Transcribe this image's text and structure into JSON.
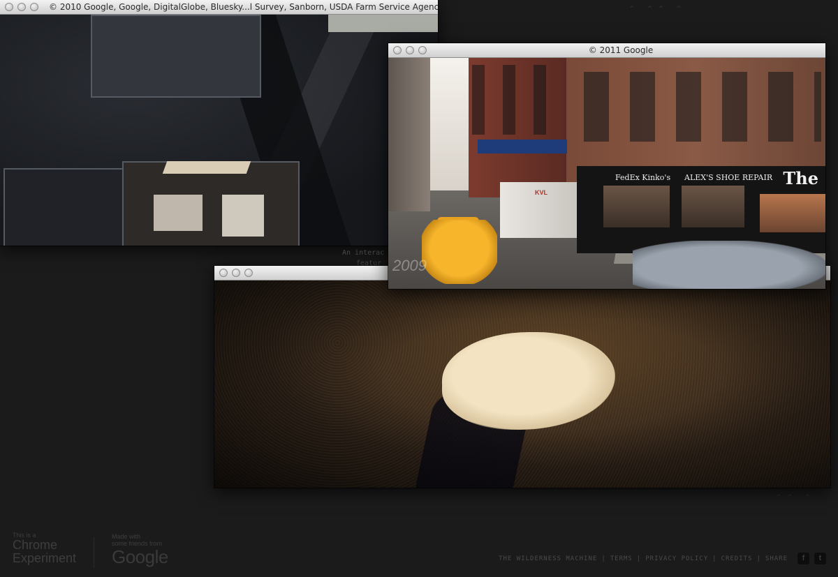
{
  "windows": {
    "aerial": {
      "title": "© 2010 Google, Google, DigitalGlobe, Bluesky...l Survey, Sanborn, USDA Farm Service Agency"
    },
    "street": {
      "title": "© 2011 Google"
    },
    "bird": {
      "title": ""
    }
  },
  "street_scene": {
    "store_sign_1": "FedEx Kinko's",
    "store_sign_2": "ALEX'S SHOE REPAIR",
    "newspaper_sign": "The",
    "truck_label": "KVL",
    "watermark": "2009"
  },
  "background_text": {
    "line1": "An interac",
    "line2": "featur"
  },
  "footer": {
    "chrome_experiment": {
      "small": "This is a",
      "line1": "Chrome",
      "line2": "Experiment"
    },
    "made_with": {
      "line1": "Made with",
      "line2": "some friends from",
      "logo": "Google"
    },
    "links": [
      "THE WILDERNESS MACHINE",
      "TERMS",
      "PRIVACY POLICY",
      "CREDITS",
      "SHARE"
    ],
    "social": {
      "facebook": "f",
      "twitter": "t"
    }
  },
  "colors": {
    "background": "#1b1b1b",
    "titlebar": "#dcdcdc",
    "taxi": "#f6b52b"
  }
}
